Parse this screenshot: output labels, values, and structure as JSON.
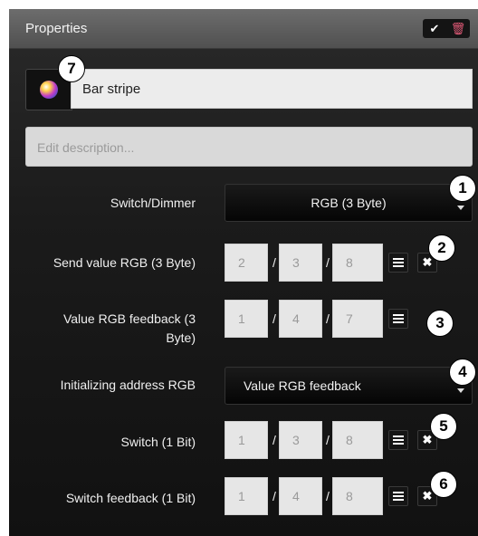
{
  "header": {
    "title": "Properties",
    "check_icon": "check-circle-icon",
    "trash_icon": "trash-icon"
  },
  "object": {
    "name": "Bar stripe",
    "color_icon": "color-orb-icon"
  },
  "description": {
    "placeholder": "Edit description..."
  },
  "rows": {
    "switch_dimmer": {
      "label": "Switch/Dimmer",
      "value": "RGB (3 Byte)"
    },
    "send_value": {
      "label": "Send value RGB (3 Byte)",
      "main": "2",
      "middle": "3",
      "sub": "8"
    },
    "value_feedback": {
      "label_line1": "Value RGB feedback (3",
      "label_line2": "Byte)",
      "main": "1",
      "middle": "4",
      "sub": "7"
    },
    "init_address": {
      "label": "Initializing address RGB",
      "value": "Value RGB feedback"
    },
    "switch_1bit": {
      "label": "Switch (1 Bit)",
      "main": "1",
      "middle": "3",
      "sub": "8"
    },
    "switch_feedback": {
      "label": "Switch feedback (1 Bit)",
      "main": "1",
      "middle": "4",
      "sub": "8"
    }
  },
  "separator": "/",
  "callouts": [
    "1",
    "2",
    "3",
    "4",
    "5",
    "6",
    "7"
  ],
  "colors": {
    "accent_trash": "#e05a77",
    "panel_bg": "#1b1b1b",
    "header_bg": "#5e5e5e"
  }
}
